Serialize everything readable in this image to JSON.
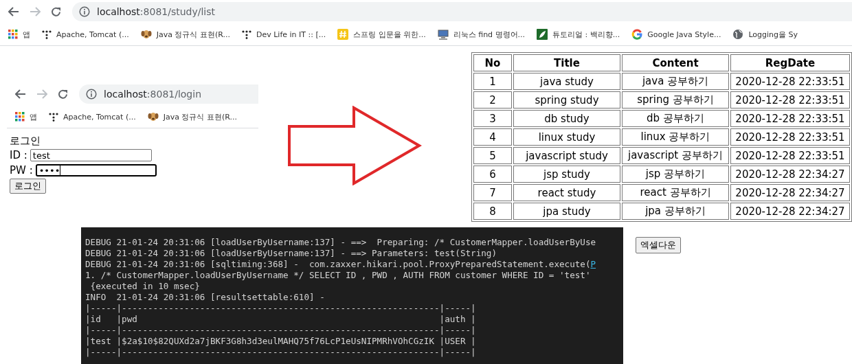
{
  "list_browser": {
    "nav": {
      "forward_enabled": false
    },
    "address": {
      "host": "localhost",
      "path": ":8081/study/list"
    },
    "bookmarks": [
      {
        "kind": "apps",
        "label": "앱"
      },
      {
        "kind": "dots",
        "label": "Apache, Tomcat (..."
      },
      {
        "kind": "dog",
        "label": "Java 정규식 표현(R..."
      },
      {
        "kind": "dots",
        "label": "Dev Life in IT :: [..."
      },
      {
        "kind": "hash",
        "label": "스프링 입문을 위한..."
      },
      {
        "kind": "computer",
        "label": "리눅스 find 명령어..."
      },
      {
        "kind": "leaf",
        "label": "튜토리얼 : 백리향..."
      },
      {
        "kind": "google",
        "label": "Google Java Style..."
      },
      {
        "kind": "globe",
        "label": "Logging을 Sy"
      }
    ]
  },
  "login_page": {
    "browser": {
      "nav": {
        "forward_enabled": false
      },
      "address": {
        "host": "localhost",
        "path": ":8081/login"
      },
      "bookmarks": [
        {
          "kind": "apps",
          "label": "앱"
        },
        {
          "kind": "dots",
          "label": "Apache, Tomcat (..."
        },
        {
          "kind": "dog",
          "label": "Java 정규식 표현(R..."
        }
      ]
    },
    "heading": "로그인",
    "fields": [
      {
        "label": "ID :",
        "value": "test",
        "focused": false
      },
      {
        "label": "PW :",
        "value": "••••",
        "focused": true
      }
    ],
    "submit": "로그인"
  },
  "study_table": {
    "columns": [
      "No",
      "Title",
      "Content",
      "RegDate"
    ],
    "rows": [
      [
        "1",
        "java study",
        "java 공부하기",
        "2020-12-28 22:33:51"
      ],
      [
        "2",
        "spring study",
        "spring 공부하기",
        "2020-12-28 22:33:51"
      ],
      [
        "3",
        "db study",
        "db 공부하기",
        "2020-12-28 22:33:51"
      ],
      [
        "4",
        "linux study",
        "linux 공부하기",
        "2020-12-28 22:33:51"
      ],
      [
        "5",
        "javascript study",
        "javascript 공부하기",
        "2020-12-28 22:33:51"
      ],
      [
        "6",
        "jsp study",
        "jsp 공부하기",
        "2020-12-28 22:34:27"
      ],
      [
        "7",
        "react study",
        "react 공부하기",
        "2020-12-28 22:34:27"
      ],
      [
        "8",
        "jpa study",
        "jpa 공부하기",
        "2020-12-28 22:34:27"
      ]
    ]
  },
  "console": {
    "lines": [
      {
        "text": "DEBUG 21-01-24 20:31:06 [loadUserByUsername:137] - ==>  Preparing: /* CustomerMapper.loadUserByUse"
      },
      {
        "text": "DEBUG 21-01-24 20:31:06 [loadUserByUsername:137] - ==> Parameters: test(String)"
      },
      {
        "text": "DEBUG 21-01-24 20:31:06 [sqltiming:368] -  com.zaxxer.hikari.pool.ProxyPreparedStatement.execute(",
        "link": "P"
      },
      {
        "text": "1. /* CustomerMapper.loadUserByUsername */ SELECT ID , PWD , AUTH FROM customer WHERE ID = 'test'"
      },
      {
        "text": " {executed in 10 msec}"
      },
      {
        "text": "INFO  21-01-24 20:31:06 [resultsettable:610] -"
      },
      {
        "text": "|-----|-------------------------------------------------------------|-----|"
      },
      {
        "text": "|id   |pwd                                                          |auth |"
      },
      {
        "text": "|-----|-------------------------------------------------------------|-----|"
      },
      {
        "text": "|test |$2a$10$82QUXd2a7jBKF3G8h3d3eulMAHQ75f76LcP1eUsNIPMRhVOhCGzIK |USER |"
      },
      {
        "text": "|-----|-------------------------------------------------------------|-----|"
      }
    ]
  },
  "excel_button": "엑셀다운"
}
